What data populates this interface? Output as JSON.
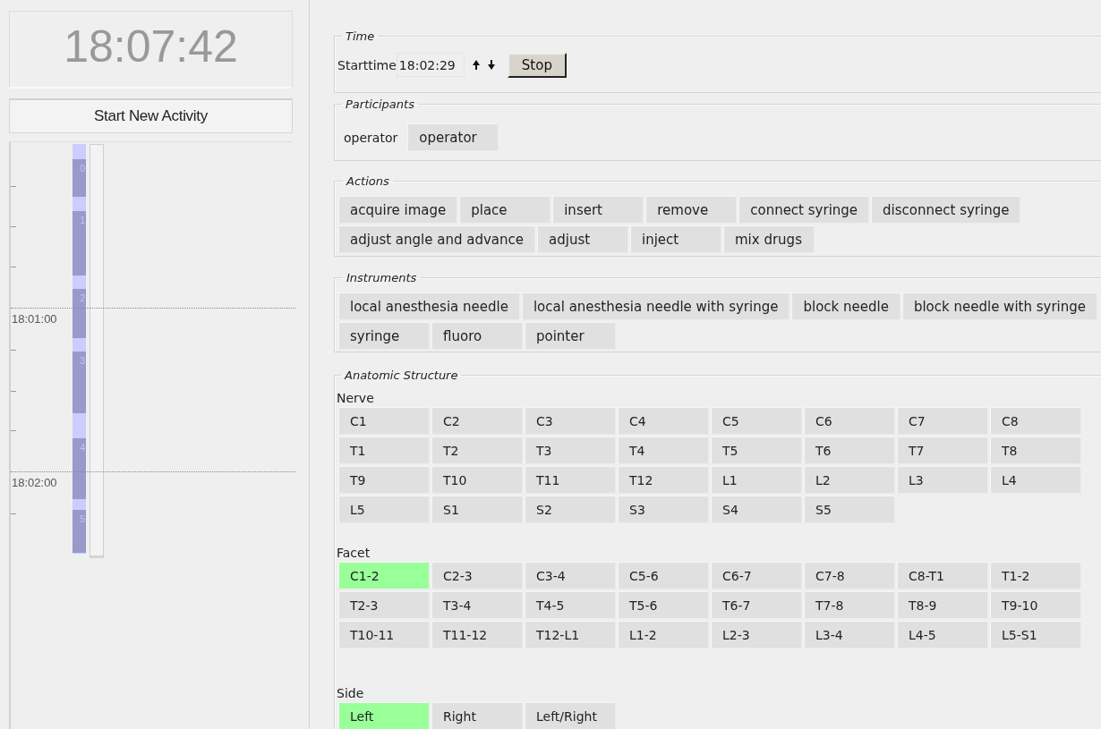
{
  "clock": "18:07:42",
  "start_button": "Start New Activity",
  "timeline": {
    "activities": [
      {
        "label": "0"
      },
      {
        "label": "1"
      },
      {
        "label": "2"
      },
      {
        "label": "3"
      },
      {
        "label": "4"
      },
      {
        "label": "5"
      }
    ],
    "time_labels": [
      "18:01:00",
      "18:02:00"
    ]
  },
  "time": {
    "legend": "Time",
    "label": "Starttime",
    "value": "18:02:29",
    "stop_button": "Stop"
  },
  "participants": {
    "legend": "Participants",
    "label": "operator",
    "buttons": [
      {
        "label": "operator",
        "selected": false
      }
    ]
  },
  "actions": {
    "legend": "Actions",
    "buttons": [
      {
        "label": "acquire image",
        "selected": false
      },
      {
        "label": "place",
        "selected": false
      },
      {
        "label": "insert",
        "selected": false
      },
      {
        "label": "remove",
        "selected": false
      },
      {
        "label": "connect syringe",
        "selected": false
      },
      {
        "label": "disconnect syringe",
        "selected": false
      },
      {
        "label": "adjust angle and advance",
        "selected": false
      },
      {
        "label": "adjust",
        "selected": false
      },
      {
        "label": "inject",
        "selected": false
      },
      {
        "label": "mix drugs",
        "selected": false
      }
    ]
  },
  "instruments": {
    "legend": "Instruments",
    "buttons": [
      {
        "label": "local anesthesia needle",
        "selected": false
      },
      {
        "label": "local anesthesia needle with syringe",
        "selected": false
      },
      {
        "label": "block needle",
        "selected": false
      },
      {
        "label": "block needle with syringe",
        "selected": false
      },
      {
        "label": "syringe",
        "selected": false
      },
      {
        "label": "fluoro",
        "selected": false
      },
      {
        "label": "pointer",
        "selected": false
      }
    ]
  },
  "anatomic_structure": {
    "legend": "Anatomic Structure",
    "groups": [
      {
        "label": "Nerve",
        "buttons": [
          {
            "label": "C1",
            "selected": false
          },
          {
            "label": "C2",
            "selected": false
          },
          {
            "label": "C3",
            "selected": false
          },
          {
            "label": "C4",
            "selected": false
          },
          {
            "label": "C5",
            "selected": false
          },
          {
            "label": "C6",
            "selected": false
          },
          {
            "label": "C7",
            "selected": false
          },
          {
            "label": "C8",
            "selected": false
          },
          {
            "label": "T1",
            "selected": false
          },
          {
            "label": "T2",
            "selected": false
          },
          {
            "label": "T3",
            "selected": false
          },
          {
            "label": "T4",
            "selected": false
          },
          {
            "label": "T5",
            "selected": false
          },
          {
            "label": "T6",
            "selected": false
          },
          {
            "label": "T7",
            "selected": false
          },
          {
            "label": "T8",
            "selected": false
          },
          {
            "label": "T9",
            "selected": false
          },
          {
            "label": "T10",
            "selected": false
          },
          {
            "label": "T11",
            "selected": false
          },
          {
            "label": "T12",
            "selected": false
          },
          {
            "label": "L1",
            "selected": false
          },
          {
            "label": "L2",
            "selected": false
          },
          {
            "label": "L3",
            "selected": false
          },
          {
            "label": "L4",
            "selected": false
          },
          {
            "label": "L5",
            "selected": false
          },
          {
            "label": "S1",
            "selected": false
          },
          {
            "label": "S2",
            "selected": false
          },
          {
            "label": "S3",
            "selected": false
          },
          {
            "label": "S4",
            "selected": false
          },
          {
            "label": "S5",
            "selected": false
          }
        ]
      },
      {
        "label": "Facet",
        "buttons": [
          {
            "label": "C1-2",
            "selected": true
          },
          {
            "label": "C2-3",
            "selected": false
          },
          {
            "label": "C3-4",
            "selected": false
          },
          {
            "label": "C5-6",
            "selected": false
          },
          {
            "label": "C6-7",
            "selected": false
          },
          {
            "label": "C7-8",
            "selected": false
          },
          {
            "label": "C8-T1",
            "selected": false
          },
          {
            "label": "T1-2",
            "selected": false
          },
          {
            "label": "T2-3",
            "selected": false
          },
          {
            "label": "T3-4",
            "selected": false
          },
          {
            "label": "T4-5",
            "selected": false
          },
          {
            "label": "T5-6",
            "selected": false
          },
          {
            "label": "T6-7",
            "selected": false
          },
          {
            "label": "T7-8",
            "selected": false
          },
          {
            "label": "T8-9",
            "selected": false
          },
          {
            "label": "T9-10",
            "selected": false
          },
          {
            "label": "T10-11",
            "selected": false
          },
          {
            "label": "T11-12",
            "selected": false
          },
          {
            "label": "T12-L1",
            "selected": false
          },
          {
            "label": "L1-2",
            "selected": false
          },
          {
            "label": "L2-3",
            "selected": false
          },
          {
            "label": "L3-4",
            "selected": false
          },
          {
            "label": "L4-5",
            "selected": false
          },
          {
            "label": "L5-S1",
            "selected": false
          }
        ]
      },
      {
        "label": "Side",
        "buttons": [
          {
            "label": "Left",
            "selected": true
          },
          {
            "label": "Right",
            "selected": false
          },
          {
            "label": "Left/Right",
            "selected": false
          }
        ]
      }
    ]
  }
}
